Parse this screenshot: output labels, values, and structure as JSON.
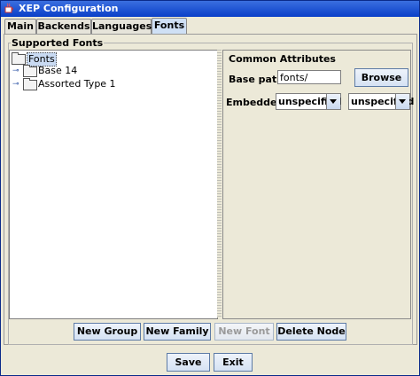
{
  "window": {
    "title": "XEP Configuration"
  },
  "tabs": [
    {
      "label": "Main"
    },
    {
      "label": "Backends"
    },
    {
      "label": "Languages"
    },
    {
      "label": "Fonts"
    }
  ],
  "fonts_panel": {
    "group_title": "Supported Fonts",
    "tree": {
      "root": "Fonts",
      "children": [
        "Base 14",
        "Assorted Type 1"
      ]
    },
    "common_attributes": {
      "title": "Common Attributes",
      "base_path_label": "Base path:",
      "base_path_value": "fonts/",
      "browse_label": "Browse",
      "embedded_label": "Embedded:",
      "embedded_value_1": "unspecified",
      "embedded_value_2": "unspecified"
    },
    "buttons": {
      "new_group": "New Group",
      "new_family": "New Family",
      "new_font": "New Font",
      "delete_node": "Delete Node"
    }
  },
  "footer": {
    "save": "Save",
    "exit": "Exit"
  },
  "colors": {
    "titlebar": "#0a3fc8",
    "active_tab": "#cfe0f5",
    "button_border": "#5d7ba6"
  }
}
